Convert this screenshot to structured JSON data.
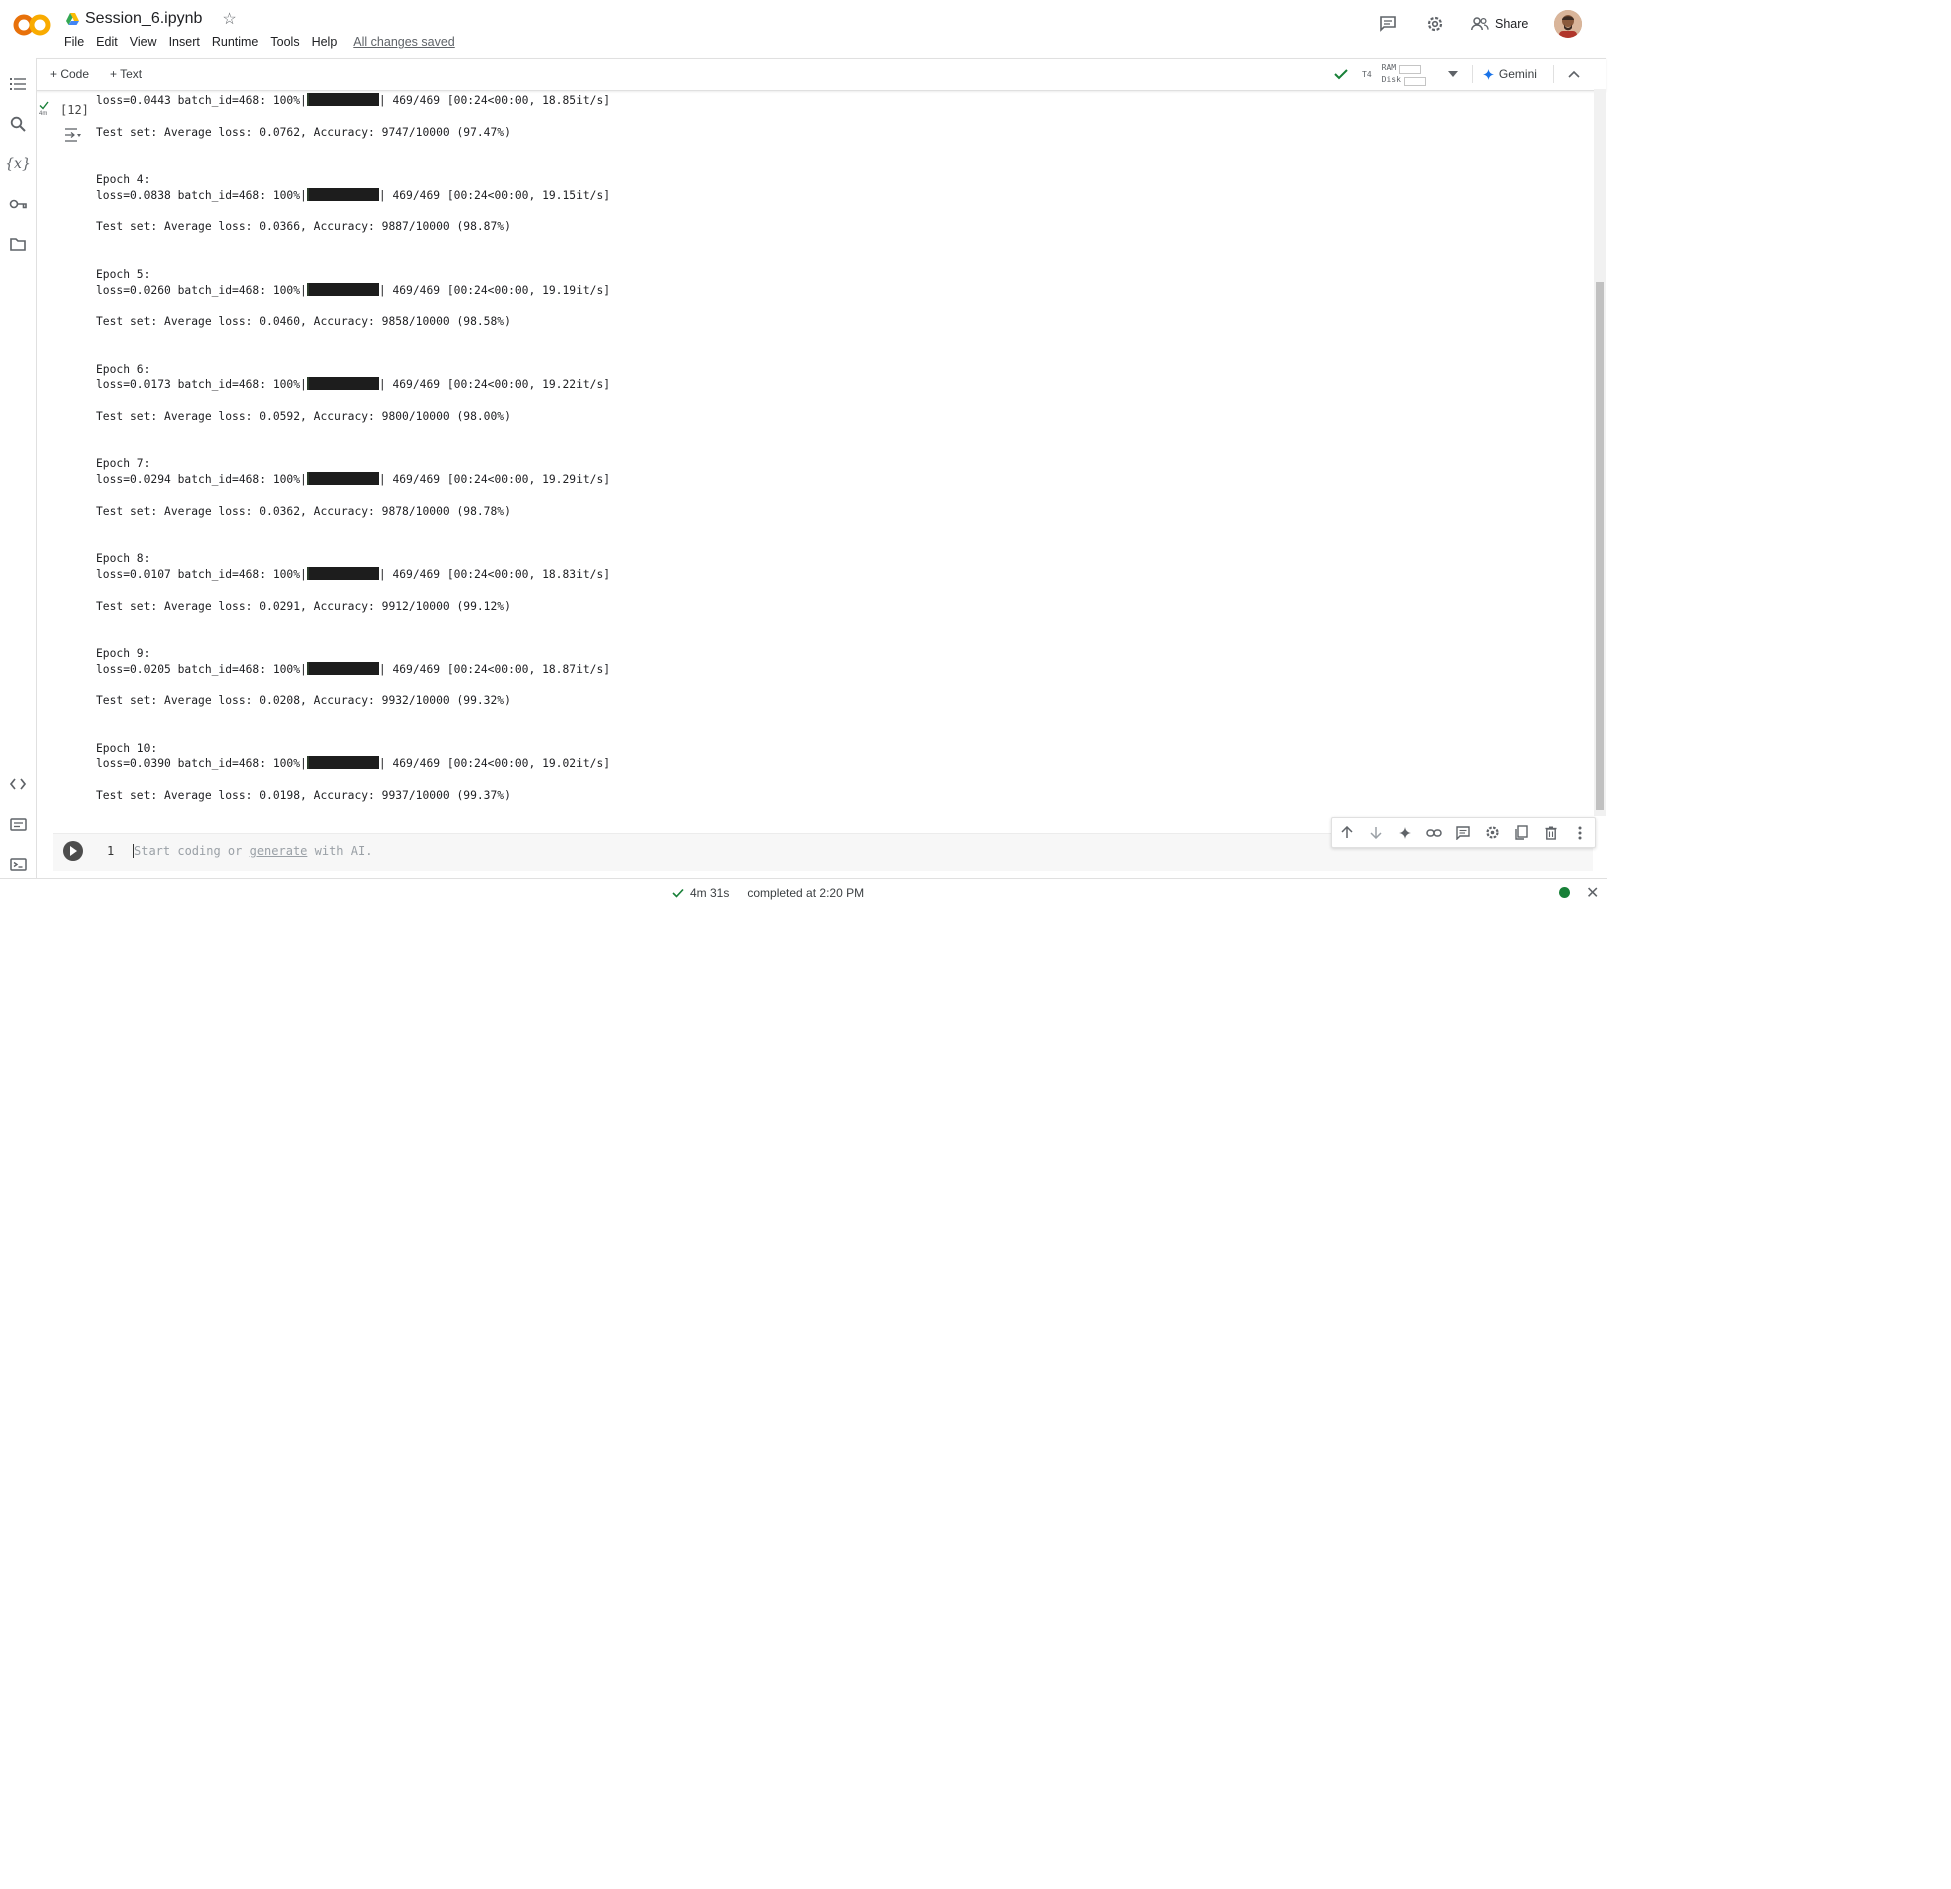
{
  "app": {
    "title": "Session_6.ipynb",
    "menu": [
      "File",
      "Edit",
      "View",
      "Insert",
      "Runtime",
      "Tools",
      "Help"
    ],
    "save_status": "All changes saved",
    "share_label": "Share"
  },
  "toolbar": {
    "add_code": "+ Code",
    "add_text": "+ Text",
    "runtime_type": "T4",
    "ram_label": "RAM",
    "disk_label": "Disk",
    "gemini_label": "Gemini"
  },
  "cell": {
    "execution_count": "[12]",
    "elapsed_short": "4m"
  },
  "output_lines": [
    "loss=0.0443 batch_id=468: 100%|",
    "",
    "Test set: Average loss: 0.0762, Accuracy: 9747/10000 (97.47%)",
    "",
    "",
    "Epoch 4:",
    "loss=0.0838 batch_id=468: 100%|",
    "",
    "Test set: Average loss: 0.0366, Accuracy: 9887/10000 (98.87%)",
    "",
    "",
    "Epoch 5:",
    "loss=0.0260 batch_id=468: 100%|",
    "",
    "Test set: Average loss: 0.0460, Accuracy: 9858/10000 (98.58%)",
    "",
    "",
    "Epoch 6:",
    "loss=0.0173 batch_id=468: 100%|",
    "",
    "Test set: Average loss: 0.0592, Accuracy: 9800/10000 (98.00%)",
    "",
    "",
    "Epoch 7:",
    "loss=0.0294 batch_id=468: 100%|",
    "",
    "Test set: Average loss: 0.0362, Accuracy: 9878/10000 (98.78%)",
    "",
    "",
    "Epoch 8:",
    "loss=0.0107 batch_id=468: 100%|",
    "",
    "Test set: Average loss: 0.0291, Accuracy: 9912/10000 (99.12%)",
    "",
    "",
    "Epoch 9:",
    "loss=0.0205 batch_id=468: 100%|",
    "",
    "Test set: Average loss: 0.0208, Accuracy: 9932/10000 (99.32%)",
    "",
    "",
    "Epoch 10:",
    "loss=0.0390 batch_id=468: 100%|",
    "",
    "Test set: Average loss: 0.0198, Accuracy: 9937/10000 (99.37%)"
  ],
  "progress_suffixes": [
    "| 469/469 [00:24<00:00, 18.85it/s]",
    "| 469/469 [00:24<00:00, 19.15it/s]",
    "| 469/469 [00:24<00:00, 19.19it/s]",
    "| 469/469 [00:24<00:00, 19.22it/s]",
    "| 469/469 [00:24<00:00, 19.29it/s]",
    "| 469/469 [00:24<00:00, 18.83it/s]",
    "| 469/469 [00:24<00:00, 18.87it/s]",
    "| 469/469 [00:24<00:00, 19.02it/s]"
  ],
  "code_cell": {
    "line_number": "1",
    "placeholder_before": "Start coding or ",
    "placeholder_link": "generate",
    "placeholder_after": " with AI."
  },
  "status": {
    "elapsed": "4m 31s",
    "completed": "completed at 2:20 PM"
  },
  "colors": {
    "accent_green": "#188038",
    "logo_orange": "#F9AB00",
    "logo_dark_orange": "#E8710A"
  },
  "icons": {
    "sidebar": [
      "table-of-contents-icon",
      "search-icon",
      "variables-icon",
      "secrets-key-icon",
      "files-folder-icon",
      "code-snippets-icon",
      "command-palette-icon",
      "terminal-icon"
    ],
    "cell_toolbar": [
      "move-up-icon",
      "move-down-icon",
      "gemini-sparkle-icon",
      "link-icon",
      "comment-icon",
      "settings-icon",
      "mirror-cell-icon",
      "delete-icon",
      "more-vert-icon"
    ]
  }
}
